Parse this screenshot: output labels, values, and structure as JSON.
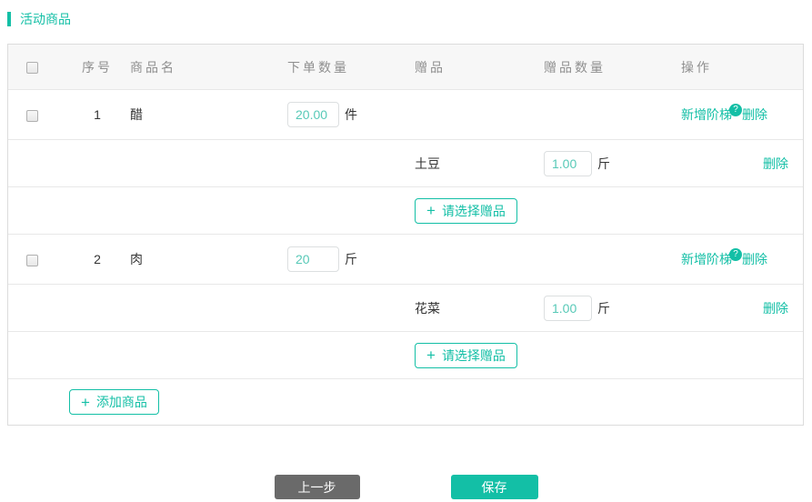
{
  "colors": {
    "accent": "#13bfa6",
    "input_value_text": "#57c9b7",
    "prev_button_bg": "#6a6a6a"
  },
  "section": {
    "title": "活动商品"
  },
  "table": {
    "headers": [
      "序号",
      "商品名",
      "下单数量",
      "赠品",
      "赠品数量",
      "操作"
    ],
    "actions": {
      "add_tier": "新增阶梯",
      "help_badge": "?",
      "delete": "删除",
      "select_gift": "请选择赠品",
      "add_product": "添加商品",
      "plus_icon": "+"
    },
    "products": [
      {
        "index": "1",
        "name": "醋",
        "order_qty": "20.00",
        "order_unit": "件",
        "gifts": [
          {
            "name": "土豆",
            "qty": "1.00",
            "unit": "斤"
          }
        ]
      },
      {
        "index": "2",
        "name": "肉",
        "order_qty": "20",
        "order_unit": "斤",
        "gifts": [
          {
            "name": "花菜",
            "qty": "1.00",
            "unit": "斤"
          }
        ]
      }
    ]
  },
  "footer": {
    "prev_label": "上一步",
    "save_label": "保存"
  }
}
